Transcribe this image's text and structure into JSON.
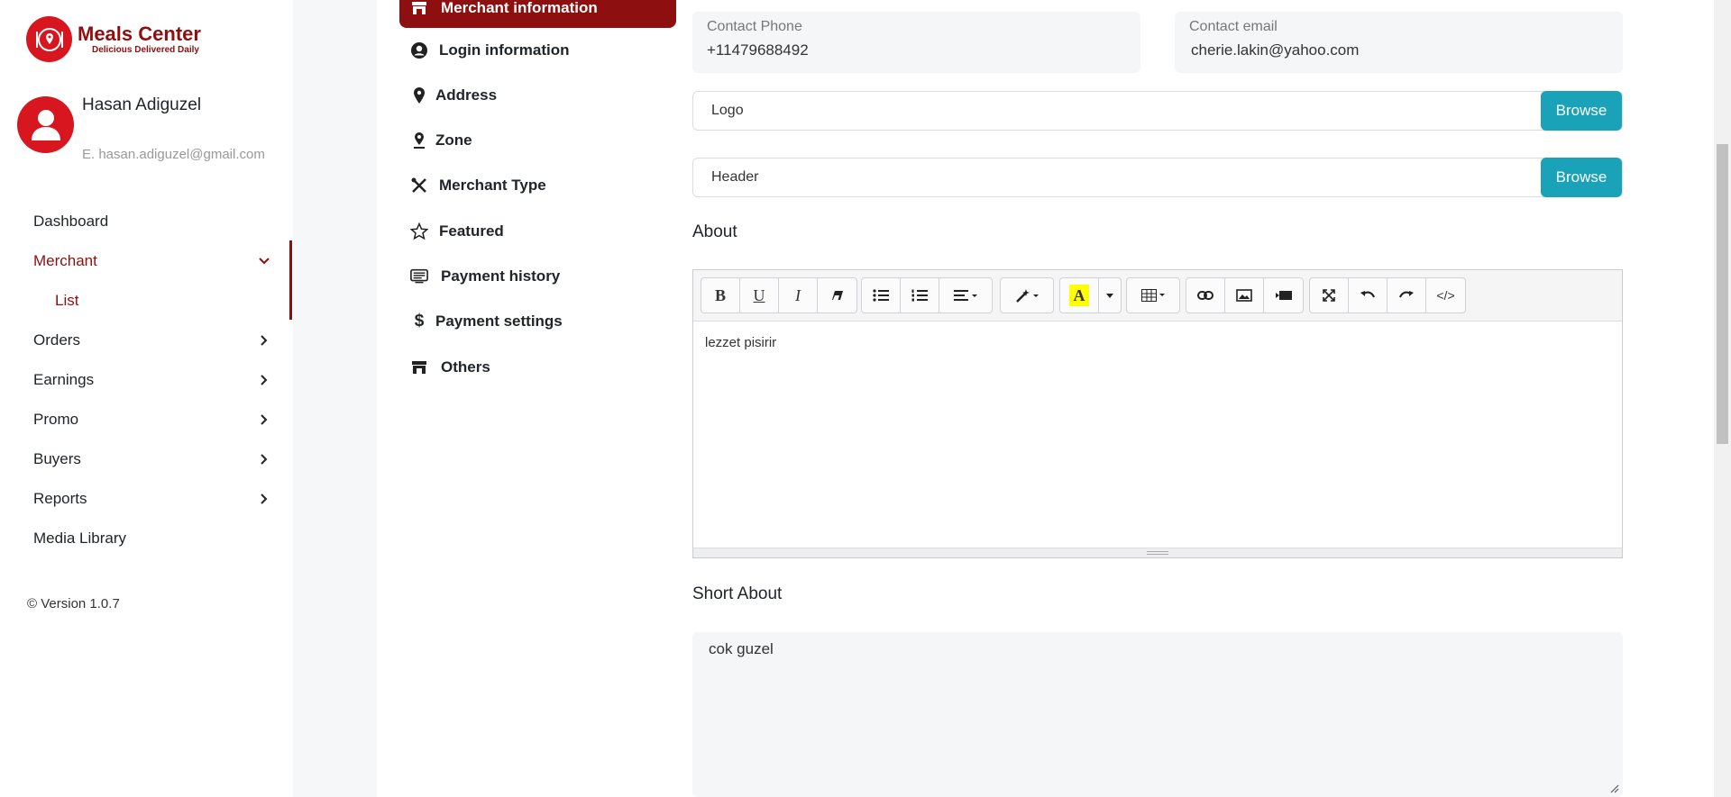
{
  "brand": {
    "name": "Meals Center",
    "tagline": "Delicious Delivered Daily"
  },
  "profile": {
    "name": "Hasan Adiguzel",
    "email": "E. hasan.adiguzel@gmail.com"
  },
  "nav": {
    "dashboard": "Dashboard",
    "merchant": "Merchant",
    "list": "List",
    "orders": "Orders",
    "earnings": "Earnings",
    "promo": "Promo",
    "buyers": "Buyers",
    "reports": "Reports",
    "media": "Media Library"
  },
  "version": "© Version 1.0.7",
  "submenu": {
    "merchant_info": "Merchant information",
    "login": "Login information",
    "address": "Address",
    "zone": "Zone",
    "merchant_type": "Merchant Type",
    "featured": "Featured",
    "payment_history": "Payment history",
    "payment_settings": "Payment settings",
    "others": "Others"
  },
  "form": {
    "phone_label": "Contact Phone",
    "phone_value": "+11479688492",
    "email_label": "Contact email",
    "email_value": "cherie.lakin@yahoo.com",
    "logo_label": "Logo",
    "header_label": "Header",
    "browse": "Browse",
    "about_title": "About",
    "about_content": "lezzet pisirir",
    "short_about_title": "Short About",
    "short_about_value": "cok guzel"
  },
  "editor_toolbar": {
    "bold": "B",
    "underline": "U",
    "italic": "I",
    "code": "</>"
  },
  "colors": {
    "brand": "#8d0f0f",
    "logo": "#d8161f",
    "browse": "#1aa3b8",
    "highlight": "#ffff00"
  }
}
